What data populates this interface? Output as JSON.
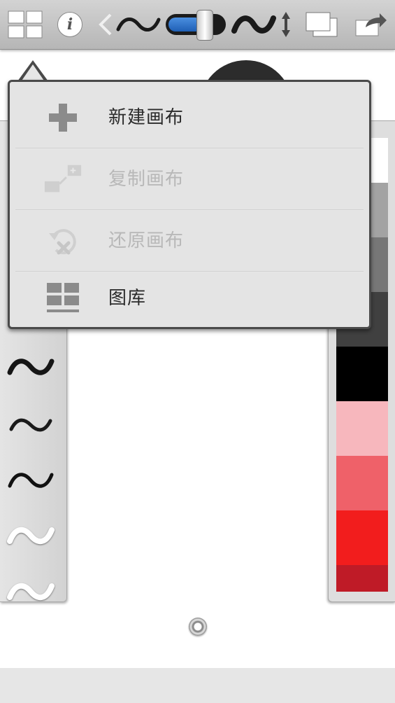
{
  "toolbar": {
    "icons": [
      "gallery-grid-icon",
      "info-icon",
      "previous-arrow-icon",
      "brush-stroke-icon",
      "brush-size-slider",
      "brush-stroke-large-icon",
      "resize-arrows-icon",
      "layers-icon",
      "share-icon"
    ],
    "info_glyph": "i"
  },
  "menu": {
    "items": [
      {
        "label": "新建画布",
        "icon": "plus-icon",
        "enabled": true
      },
      {
        "label": "复制画布",
        "icon": "duplicate-icon",
        "enabled": false
      },
      {
        "label": "还原画布",
        "icon": "revert-icon",
        "enabled": false
      },
      {
        "label": "图库",
        "icon": "gallery-icon",
        "enabled": true
      }
    ]
  },
  "brush_panel": {
    "strokes": [
      "brush-stroke-1",
      "brush-stroke-2",
      "brush-stroke-3",
      "brush-stroke-4",
      "brush-stroke-5"
    ]
  },
  "color_panel": {
    "colors": [
      "#ffffff",
      "#a3a3a3",
      "#777777",
      "#404040",
      "#000000",
      "#f7b7bd",
      "#ef6169",
      "#f21d1d",
      "#bf1b27"
    ]
  },
  "colors": {
    "toolbar": "#c4c4c4",
    "menu_background": "#e4e4e4",
    "menu_border": "#4a4a4a",
    "accent_slider": "#1f5fb5"
  }
}
